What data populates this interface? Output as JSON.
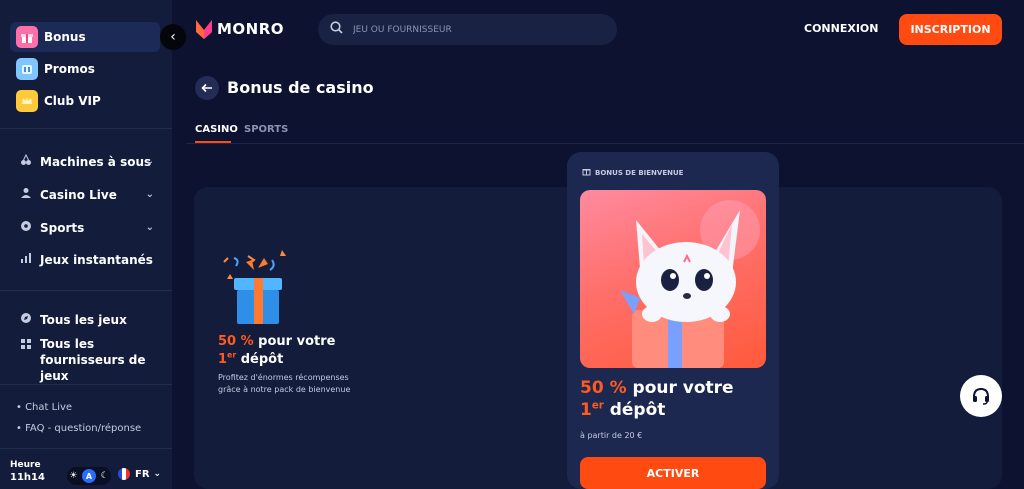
{
  "sidebar": {
    "promo_items": [
      {
        "label": "Bonus",
        "icon": "gift-icon"
      },
      {
        "label": "Promos",
        "icon": "promo-icon"
      },
      {
        "label": "Club VIP",
        "icon": "crown-icon"
      }
    ],
    "nav_items": [
      {
        "label": "Machines à sous",
        "icon": "cherry-icon",
        "has_chevron": true
      },
      {
        "label": "Casino Live",
        "icon": "dealer-icon",
        "has_chevron": true
      },
      {
        "label": "Sports",
        "icon": "ball-icon",
        "has_chevron": true
      },
      {
        "label": "Jeux instantanés",
        "icon": "bars-icon",
        "has_chevron": false
      }
    ],
    "game_items": [
      {
        "label": "Tous les jeux",
        "icon": "compass-icon"
      },
      {
        "label": "Tous les fournisseurs de jeux",
        "icon": "grid-icon"
      }
    ],
    "links": [
      "Chat Live",
      "FAQ - question/réponse"
    ],
    "time_label": "Heure",
    "time_value": "11h14",
    "theme_letter": "A",
    "language": "FR"
  },
  "header": {
    "brand": "MONRO",
    "search_placeholder": "JEU OU FOURNISSEUR",
    "login_label": "CONNEXION",
    "signup_label": "INSCRIPTION"
  },
  "page": {
    "title": "Bonus de casino",
    "tabs": [
      {
        "label": "CASINO",
        "active": true
      },
      {
        "label": "SPORTS",
        "active": false
      }
    ]
  },
  "bonus_offer": {
    "percent": "50 %",
    "title_mid": " pour votre",
    "ordinal": "1",
    "ordinal_sup": "er",
    "title_end": " dépôt",
    "description": "Profitez d'énormes récompenses grâce à notre pack de bienvenue"
  },
  "welcome_card": {
    "label": "BONUS DE BIENVENUE",
    "percent": "50 %",
    "title_mid": " pour votre",
    "ordinal": "1",
    "ordinal_sup": "er",
    "title_end": " dépôt",
    "minimum": "à partir de 20 €",
    "cta": "ACTIVER"
  },
  "colors": {
    "background": "#0c1230",
    "sidebar": "#141c3c",
    "accent": "#ff4a12"
  }
}
